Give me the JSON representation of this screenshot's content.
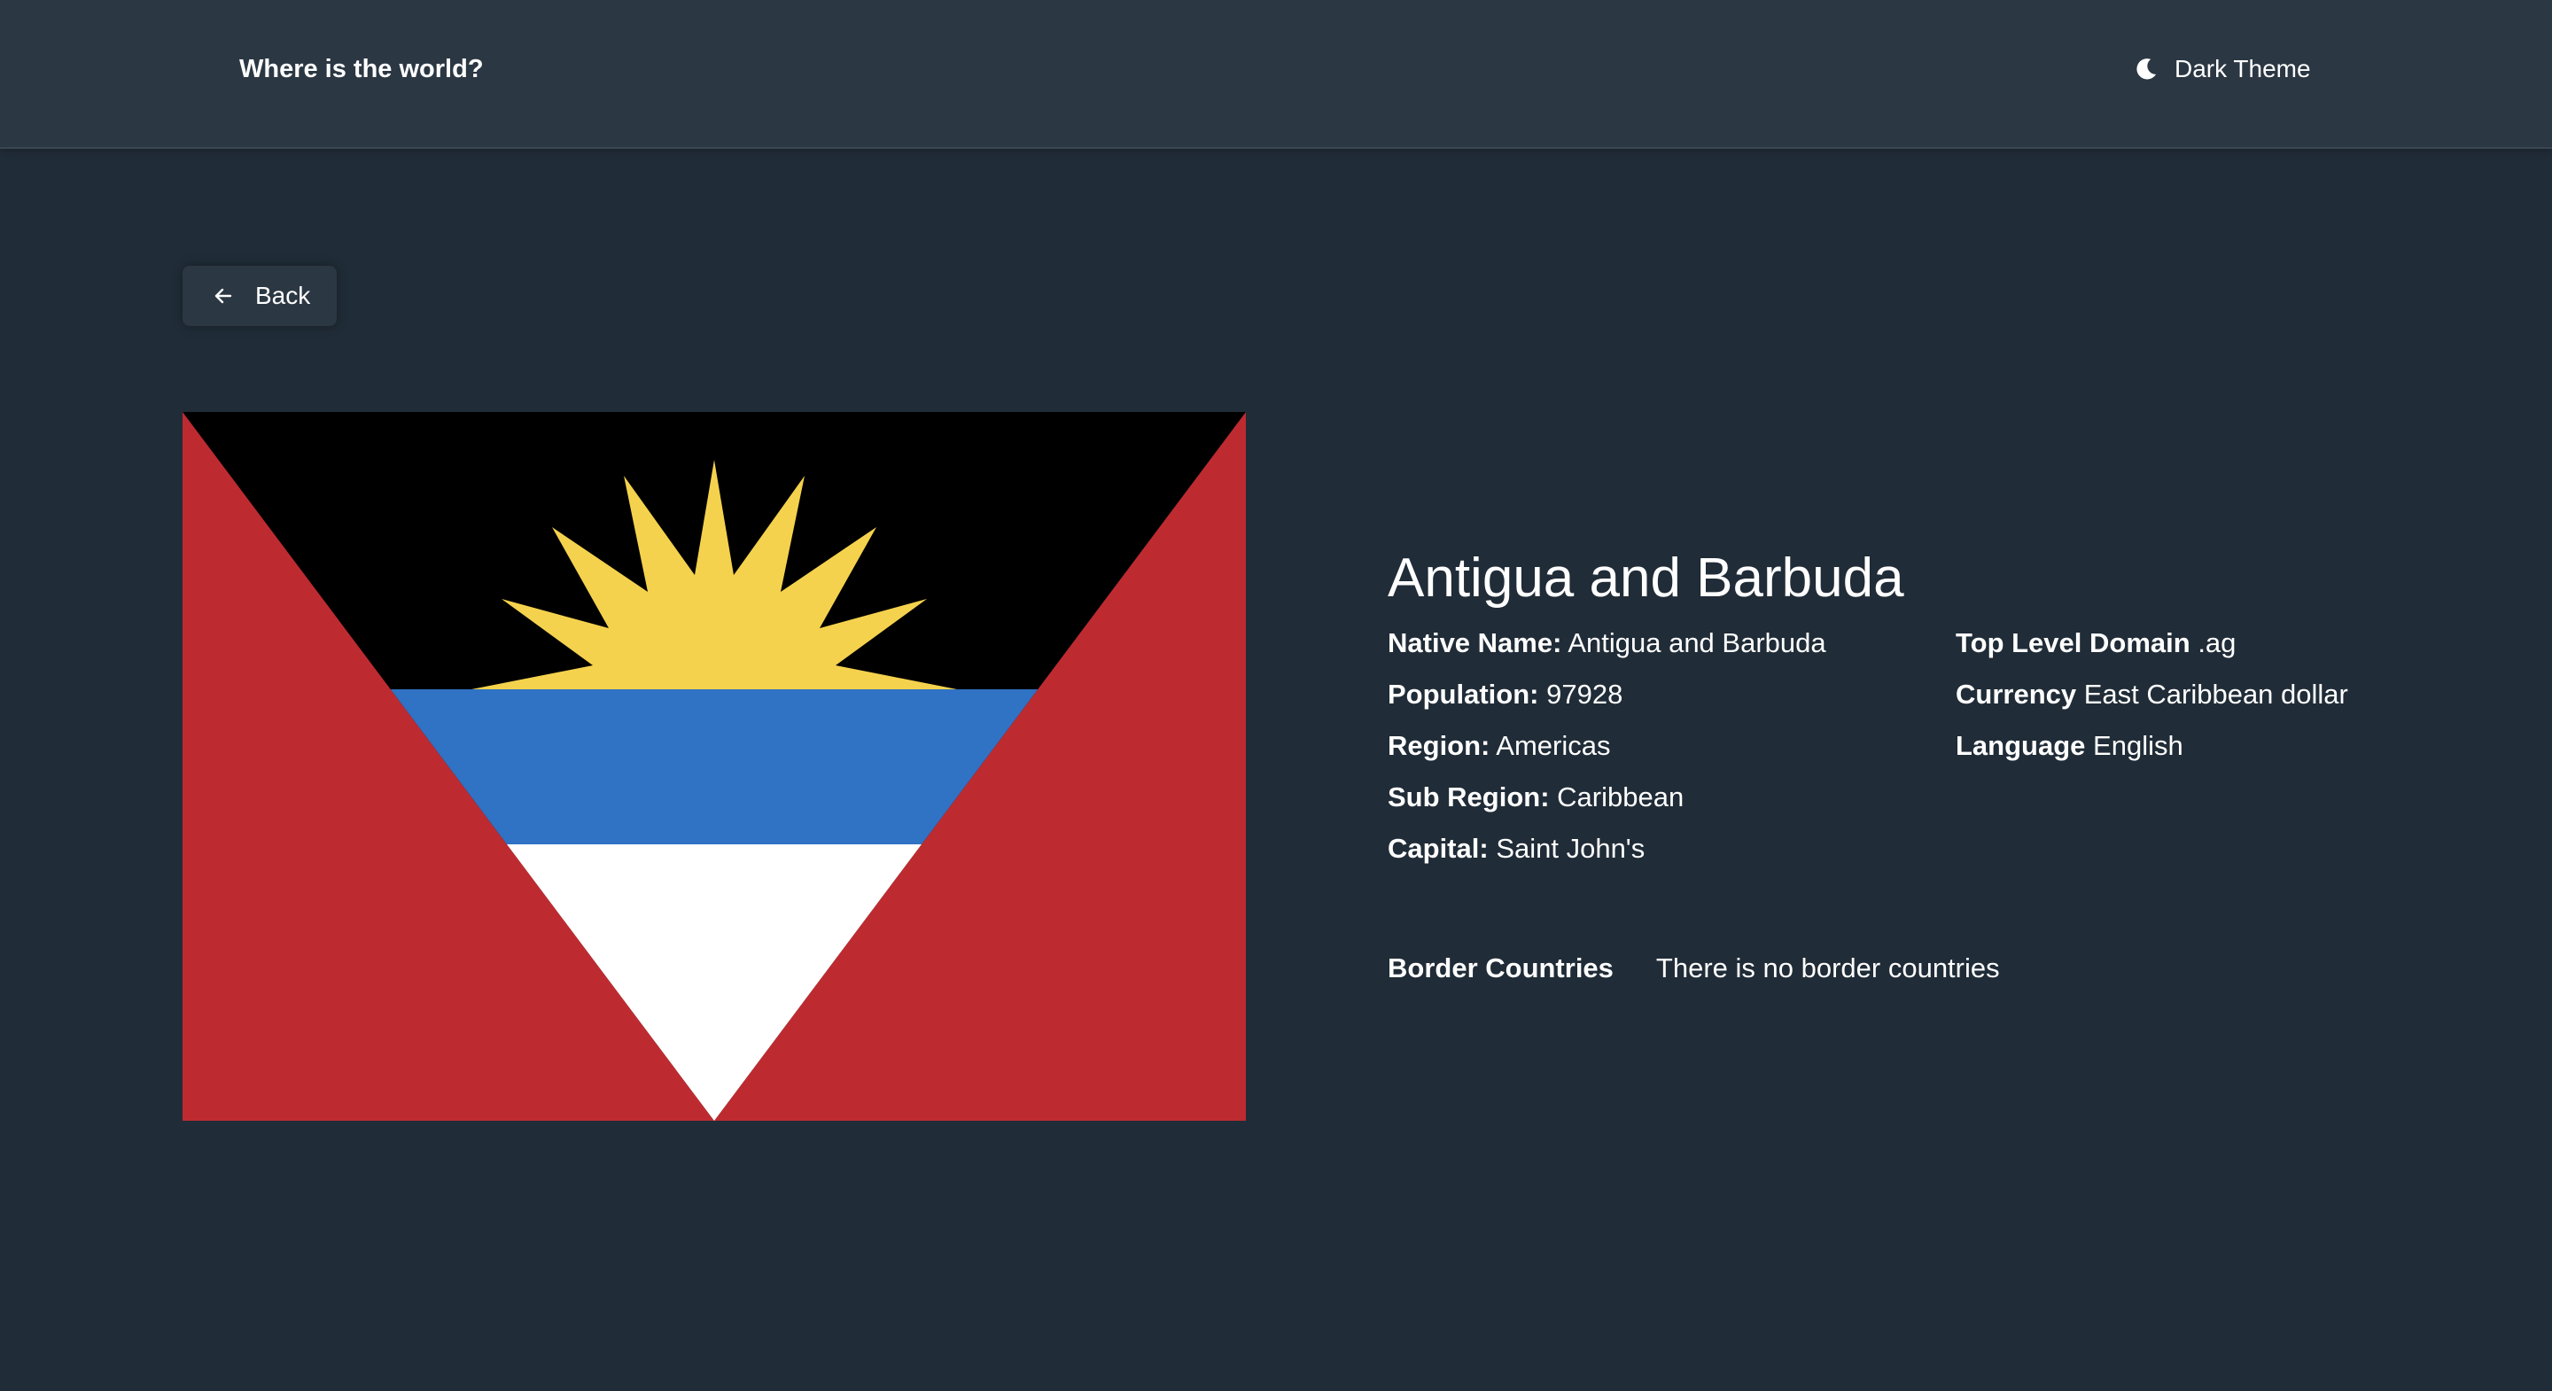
{
  "header": {
    "title": "Where is the world?",
    "theme_toggle": {
      "label": "Dark Theme",
      "icon": "moon-icon"
    }
  },
  "back_button": {
    "label": "Back",
    "icon": "arrow-left-icon"
  },
  "country": {
    "name": "Antigua and Barbuda",
    "flag": {
      "description_icon": "flag-image",
      "colors": {
        "red": "#bd2b31",
        "black": "#000000",
        "blue": "#3072c4",
        "white": "#ffffff",
        "sun": "#f5d24d"
      }
    },
    "details_left": [
      {
        "key": "Native Name:",
        "value": "Antigua and Barbuda"
      },
      {
        "key": "Population:",
        "value": "97928"
      },
      {
        "key": "Region:",
        "value": "Americas"
      },
      {
        "key": "Sub Region:",
        "value": "Caribbean"
      },
      {
        "key": "Capital:",
        "value": "Saint John's"
      }
    ],
    "details_right": [
      {
        "key": "Top Level Domain",
        "value": ".ag"
      },
      {
        "key": "Currency",
        "value": "East Caribbean dollar"
      },
      {
        "key": "Language",
        "value": "English"
      }
    ],
    "border_countries": {
      "label": "Border Countries",
      "value": "There is no border countries"
    }
  },
  "colors": {
    "background": "#202c37",
    "element": "#2b3743",
    "text": "#ffffff"
  }
}
